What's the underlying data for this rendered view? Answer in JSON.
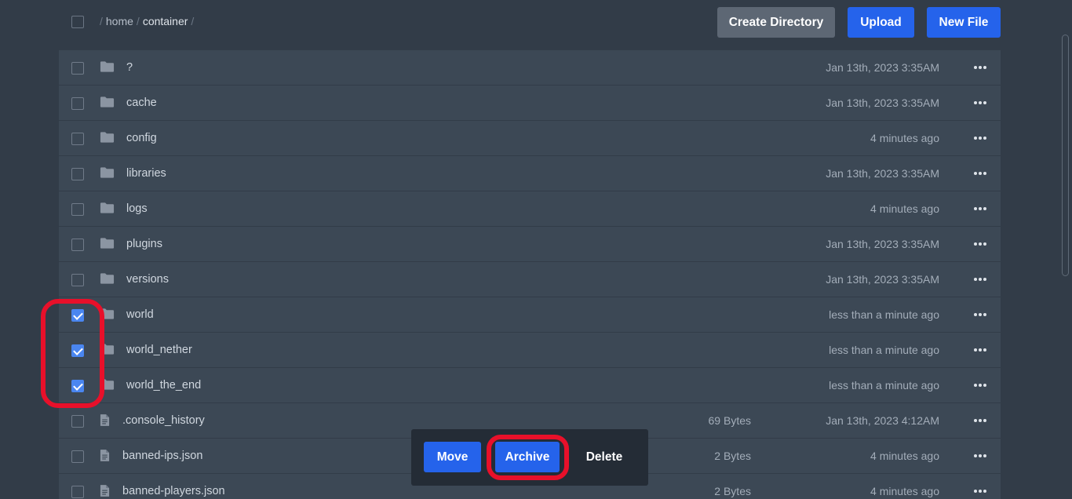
{
  "breadcrumb": {
    "home": "home",
    "current": "container",
    "separator": "/"
  },
  "toolbar": {
    "create_directory": "Create Directory",
    "upload": "Upload",
    "new_file": "New File"
  },
  "icons": {
    "folder": "folder-icon",
    "file": "file-icon",
    "more": "more-horizontal-icon"
  },
  "colors": {
    "accent": "#2563eb",
    "highlight": "#e8102a",
    "checkbox_checked": "#4a86f0"
  },
  "files": [
    {
      "name": "?",
      "type": "folder",
      "size": "",
      "modified": "Jan 13th, 2023 3:35AM",
      "checked": false
    },
    {
      "name": "cache",
      "type": "folder",
      "size": "",
      "modified": "Jan 13th, 2023 3:35AM",
      "checked": false
    },
    {
      "name": "config",
      "type": "folder",
      "size": "",
      "modified": "4 minutes ago",
      "checked": false
    },
    {
      "name": "libraries",
      "type": "folder",
      "size": "",
      "modified": "Jan 13th, 2023 3:35AM",
      "checked": false
    },
    {
      "name": "logs",
      "type": "folder",
      "size": "",
      "modified": "4 minutes ago",
      "checked": false
    },
    {
      "name": "plugins",
      "type": "folder",
      "size": "",
      "modified": "Jan 13th, 2023 3:35AM",
      "checked": false
    },
    {
      "name": "versions",
      "type": "folder",
      "size": "",
      "modified": "Jan 13th, 2023 3:35AM",
      "checked": false
    },
    {
      "name": "world",
      "type": "folder",
      "size": "",
      "modified": "less than a minute ago",
      "checked": true
    },
    {
      "name": "world_nether",
      "type": "folder",
      "size": "",
      "modified": "less than a minute ago",
      "checked": true
    },
    {
      "name": "world_the_end",
      "type": "folder",
      "size": "",
      "modified": "less than a minute ago",
      "checked": true
    },
    {
      "name": ".console_history",
      "type": "file",
      "size": "69 Bytes",
      "modified": "Jan 13th, 2023 4:12AM",
      "checked": false
    },
    {
      "name": "banned-ips.json",
      "type": "file",
      "size": "2 Bytes",
      "modified": "4 minutes ago",
      "checked": false
    },
    {
      "name": "banned-players.json",
      "type": "file",
      "size": "2 Bytes",
      "modified": "4 minutes ago",
      "checked": false
    }
  ],
  "bulk_actions": {
    "move": "Move",
    "archive": "Archive",
    "delete": "Delete"
  }
}
